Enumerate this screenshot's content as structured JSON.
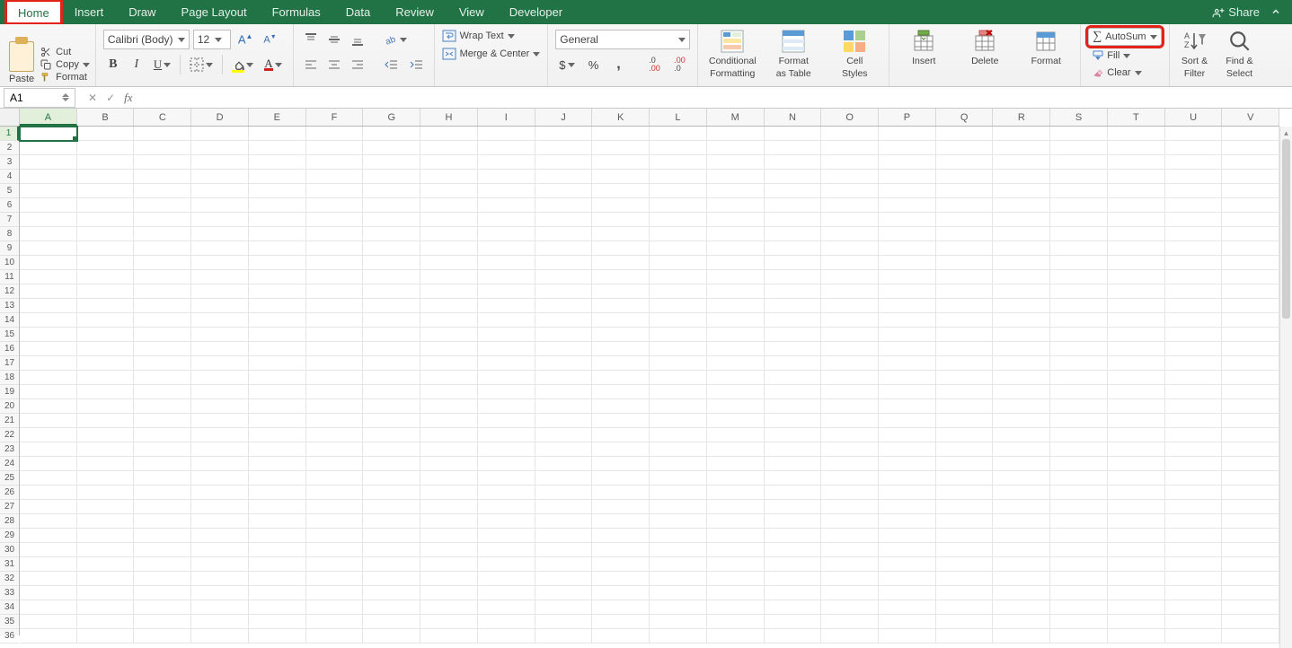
{
  "menubar": {
    "tabs": [
      "Home",
      "Insert",
      "Draw",
      "Page Layout",
      "Formulas",
      "Data",
      "Review",
      "View",
      "Developer"
    ],
    "active_index": 0,
    "share_label": "Share"
  },
  "clipboard": {
    "paste_label": "Paste",
    "cut_label": "Cut",
    "copy_label": "Copy",
    "format_label": "Format"
  },
  "font": {
    "family": "Calibri (Body)",
    "size": "12"
  },
  "wraptext_label": "Wrap Text",
  "mergecenter_label": "Merge & Center",
  "number_format": "General",
  "styles": {
    "cond_l1": "Conditional",
    "cond_l2": "Formatting",
    "fmt_l1": "Format",
    "fmt_l2": "as Table",
    "cell_l1": "Cell",
    "cell_l2": "Styles"
  },
  "cells_group": {
    "insert": "Insert",
    "delete": "Delete",
    "format": "Format"
  },
  "editing": {
    "autosum": "AutoSum",
    "fill": "Fill",
    "clear": "Clear"
  },
  "sortfilter": {
    "l1": "Sort &",
    "l2": "Filter"
  },
  "findselect": {
    "l1": "Find &",
    "l2": "Select"
  },
  "namebox": "A1",
  "columns": [
    "A",
    "B",
    "C",
    "D",
    "E",
    "F",
    "G",
    "H",
    "I",
    "J",
    "K",
    "L",
    "M",
    "N",
    "O",
    "P",
    "Q",
    "R",
    "S",
    "T",
    "U",
    "V"
  ],
  "active_col_index": 0,
  "rows": [
    "1",
    "2",
    "3",
    "4",
    "5",
    "6",
    "7",
    "8",
    "9",
    "10",
    "11",
    "12",
    "13",
    "14",
    "15",
    "16",
    "17",
    "18",
    "19",
    "20",
    "21",
    "22",
    "23",
    "24",
    "25",
    "26",
    "27",
    "28",
    "29",
    "30",
    "31",
    "32",
    "33",
    "34",
    "35",
    "36"
  ],
  "active_row_index": 0,
  "formula_value": "",
  "colors": {
    "brand": "#217346",
    "highlight": "#e2231a"
  }
}
